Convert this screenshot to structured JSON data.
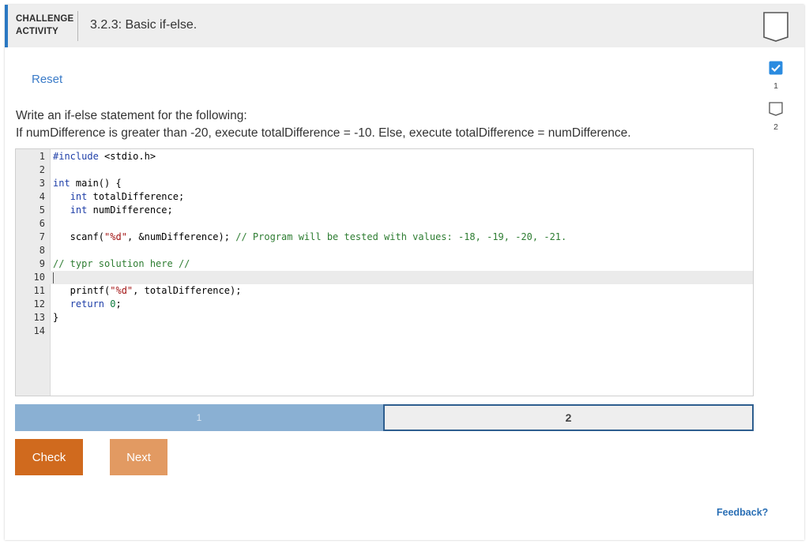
{
  "header": {
    "kind_line1": "CHALLENGE",
    "kind_line2": "ACTIVITY",
    "title": "3.2.3: Basic if-else."
  },
  "reset_label": "Reset",
  "prompt": {
    "line1": "Write an if-else statement for the following:",
    "line2": "If numDifference is greater than -20, execute totalDifference = -10. Else, execute totalDifference = numDifference."
  },
  "editor": {
    "line_numbers": [
      "1",
      "2",
      "3",
      "4",
      "5",
      "6",
      "7",
      "8",
      "9",
      "10",
      "11",
      "12",
      "13",
      "14"
    ],
    "lines": [
      "#include <stdio.h>",
      "",
      "int main() {",
      "   int totalDifference;",
      "   int numDifference;",
      "",
      "   scanf(\"%d\", &numDifference); // Program will be tested with values: -18, -19, -20, -21.",
      "",
      "// typr solution here //",
      "",
      "   printf(\"%d\", totalDifference);",
      "   return 0;",
      "}",
      ""
    ],
    "active_line": 10
  },
  "progress": {
    "seg1_label": "1",
    "seg2_label": "2",
    "current": 2
  },
  "buttons": {
    "check": "Check",
    "next": "Next"
  },
  "levels": [
    {
      "label": "1",
      "completed": true
    },
    {
      "label": "2",
      "completed": false
    }
  ],
  "feedback_label": "Feedback?",
  "colors": {
    "accent": "#2a78c2",
    "check_button": "#d06a1e",
    "next_button": "#e29a62",
    "progress_done": "#8ab0d3",
    "progress_current_border": "#2e5e8f"
  }
}
